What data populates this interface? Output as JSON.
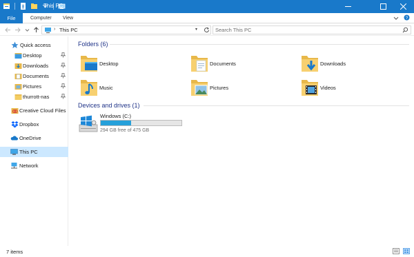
{
  "window": {
    "title": "This PC",
    "accent": "#1979ca"
  },
  "ribbon": {
    "tabs": [
      "File",
      "Computer",
      "View"
    ]
  },
  "address": {
    "location": "This PC",
    "search_placeholder": "Search This PC"
  },
  "nav": {
    "items": [
      {
        "label": "Quick access",
        "icon": "star-icon"
      },
      {
        "label": "Desktop",
        "icon": "folder-icon",
        "pinned": true
      },
      {
        "label": "Downloads",
        "icon": "downloads-folder-icon",
        "pinned": true
      },
      {
        "label": "Documents",
        "icon": "documents-folder-icon",
        "pinned": true
      },
      {
        "label": "Pictures",
        "icon": "pictures-folder-icon",
        "pinned": true
      },
      {
        "label": "thurrott-nas",
        "icon": "folder-icon",
        "pinned": true
      },
      {
        "label": "Creative Cloud Files",
        "icon": "creative-cloud-icon"
      },
      {
        "label": "Dropbox",
        "icon": "dropbox-icon"
      },
      {
        "label": "OneDrive",
        "icon": "cloud-icon"
      },
      {
        "label": "This PC",
        "icon": "computer-icon",
        "selected": true
      },
      {
        "label": "Network",
        "icon": "network-icon"
      }
    ]
  },
  "folders": {
    "header": "Folders (6)",
    "items": [
      {
        "label": "Desktop",
        "icon": "desktop-folder-icon"
      },
      {
        "label": "Documents",
        "icon": "documents-folder-icon"
      },
      {
        "label": "Downloads",
        "icon": "downloads-folder-icon"
      },
      {
        "label": "Music",
        "icon": "music-folder-icon"
      },
      {
        "label": "Pictures",
        "icon": "pictures-folder-icon"
      },
      {
        "label": "Videos",
        "icon": "videos-folder-icon"
      }
    ]
  },
  "devices": {
    "header": "Devices and drives (1)",
    "drives": [
      {
        "name": "Windows (C:)",
        "free_text": "294 GB free of 475 GB",
        "used_fraction": 0.38,
        "bar_color": "#26a0da"
      }
    ]
  },
  "status": {
    "items_text": "7 items"
  }
}
